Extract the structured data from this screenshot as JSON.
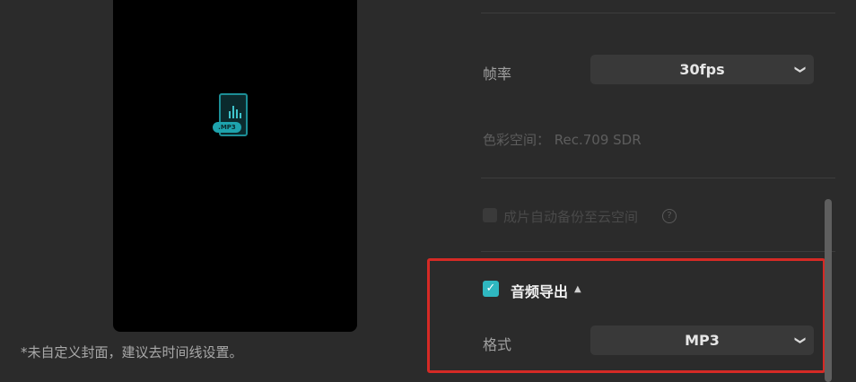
{
  "preview": {
    "file_badge": ".MP3",
    "cover_note": "*未自定义封面，建议去时间线设置。"
  },
  "settings": {
    "frame_rate": {
      "label": "帧率",
      "value": "30fps"
    },
    "color_space": {
      "text": "色彩空间： Rec.709 SDR"
    },
    "cloud_backup": {
      "label": "成片自动备份至云空间",
      "checked": false,
      "disabled": true
    },
    "audio_export": {
      "label": "音频导出",
      "checked": true,
      "expanded": true
    },
    "format": {
      "label": "格式",
      "value": "MP3"
    }
  },
  "colors": {
    "accent": "#2fb7c0",
    "highlight_border": "#d52a25",
    "background": "#2b2b2b"
  },
  "icons": {
    "file": "audio-file-icon",
    "dropdown": "chevron-down-icon",
    "help": "question-circle-icon",
    "check": "checkmark-icon",
    "collapse": "caret-up-icon"
  }
}
